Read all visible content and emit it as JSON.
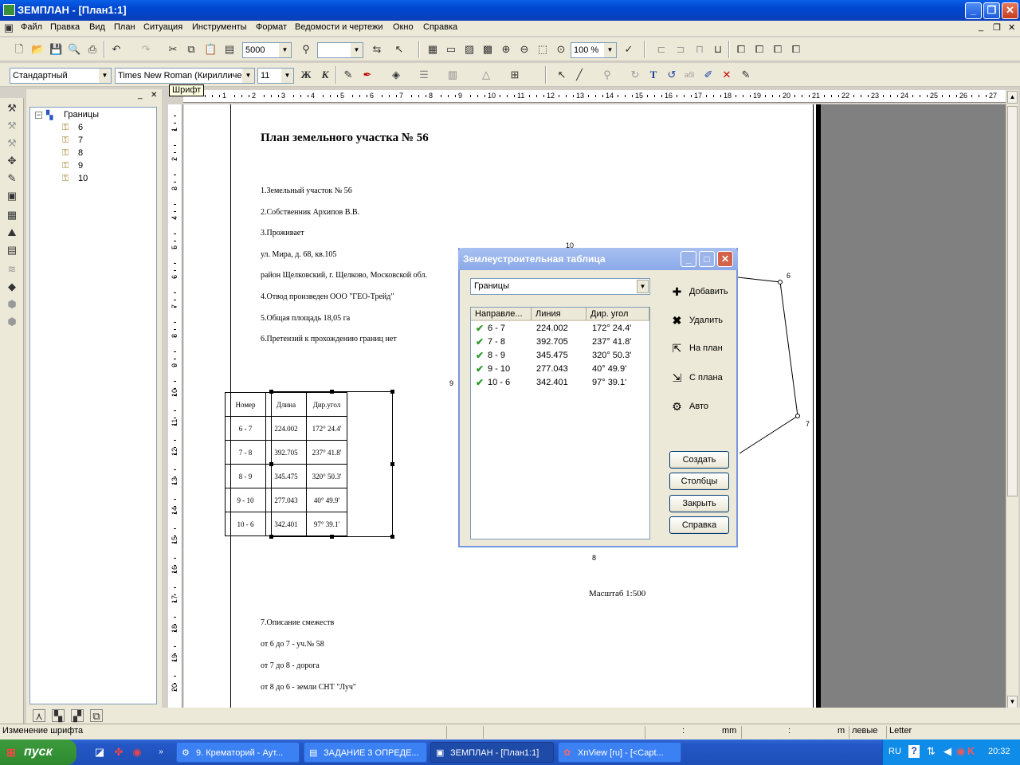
{
  "window": {
    "title": "ЗЕМПЛАН - [План1:1]"
  },
  "menu": [
    "Файл",
    "Правка",
    "Вид",
    "План",
    "Ситуация",
    "Инструменты",
    "Формат",
    "Ведомости и чертежи",
    "Окно",
    "Справка"
  ],
  "toolbar": {
    "scale_value": "5000",
    "zoom_value": "100 %"
  },
  "formatbar": {
    "style_value": "Стандартный",
    "font_value": "Times New Roman (Кирилличес",
    "size_value": "11",
    "bold_label": "Ж",
    "italic_label": "К",
    "tooltip": "Шрифт"
  },
  "tree": {
    "root": "Границы",
    "items": [
      "6",
      "7",
      "8",
      "9",
      "10"
    ]
  },
  "ruler_h": [
    "1",
    "2",
    "3",
    "4",
    "5",
    "6",
    "7",
    "8",
    "9",
    "10",
    "11",
    "12",
    "13",
    "14",
    "15",
    "16",
    "17",
    "18",
    "19",
    "20",
    "21",
    "22",
    "23",
    "24",
    "25",
    "26",
    "27"
  ],
  "ruler_v": [
    "1",
    "2",
    "3",
    "4",
    "5",
    "6",
    "7",
    "8",
    "9",
    "10",
    "11",
    "12",
    "13",
    "14",
    "15",
    "16",
    "17",
    "18",
    "19",
    "20"
  ],
  "document": {
    "title": "План земельного участка № 56",
    "lines": [
      "1.Земельный участок № 56",
      "2.Собственник Архипов В.В.",
      "3.Проживает",
      "ул. Мира, д. 68, кв.105",
      "район Щелковский, г. Щелково, Московской обл.",
      "4.Отвод произведен ООО \"ГЕО-Трейд\"",
      "5.Общая площадь 18,05 га",
      "6.Претензий к прохождению границ нет"
    ],
    "table": {
      "headers": [
        "Номер",
        "Длина",
        "Дир.угол"
      ],
      "rows": [
        [
          "6 - 7",
          "224.002",
          "172° 24.4'"
        ],
        [
          "7 - 8",
          "392.705",
          "237° 41.8'"
        ],
        [
          "8 - 9",
          "345.475",
          "320° 50.3'"
        ],
        [
          "9 - 10",
          "277.043",
          "40° 49.9'"
        ],
        [
          "10 - 6",
          "342.401",
          "97° 39.1'"
        ]
      ]
    },
    "scale": "Масштаб 1:500",
    "adjacency_title": "7.Описание смежеств",
    "adjacency": [
      "от 6 до 7 -  уч.№ 58",
      "от 7 до 8 - дорога",
      "от 8 до 6 - земли СНТ \"Луч\""
    ],
    "point_labels": {
      "p10": "10",
      "p9": "9",
      "p6": "6",
      "p7": "7",
      "p8": "8"
    }
  },
  "dialog": {
    "title": "Землеустроительная таблица",
    "combo_value": "Границы",
    "columns": [
      "Направле...",
      "Линия",
      "Дир. угол"
    ],
    "rows": [
      [
        "6 - 7",
        "224.002",
        "172° 24.4'"
      ],
      [
        "7 - 8",
        "392.705",
        "237° 41.8'"
      ],
      [
        "8 - 9",
        "345.475",
        "320° 50.3'"
      ],
      [
        "9 - 10",
        "277.043",
        "40° 49.9'"
      ],
      [
        "10 - 6",
        "342.401",
        "97° 39.1'"
      ]
    ],
    "actions": [
      "Добавить",
      "Удалить",
      "На план",
      "С плана",
      "Авто"
    ],
    "buttons": [
      "Создать",
      "Столбцы",
      "Закрыть",
      "Справка"
    ]
  },
  "status": {
    "message": "Изменение шрифта",
    "colon1": ":",
    "unit": "mm",
    "colon2": ":",
    "unit2": "m",
    "align": "левые",
    "paper": "Letter"
  },
  "taskbar": {
    "start": "пуск",
    "tasks": [
      "9. Крематорий - Аут...",
      "ЗАДАНИЕ 3 ОПРЕДЕ...",
      "ЗЕМПЛАН - [План1:1]",
      "XnView [ru] - [<Capt..."
    ],
    "lang": "RU",
    "clock": "20:32"
  }
}
